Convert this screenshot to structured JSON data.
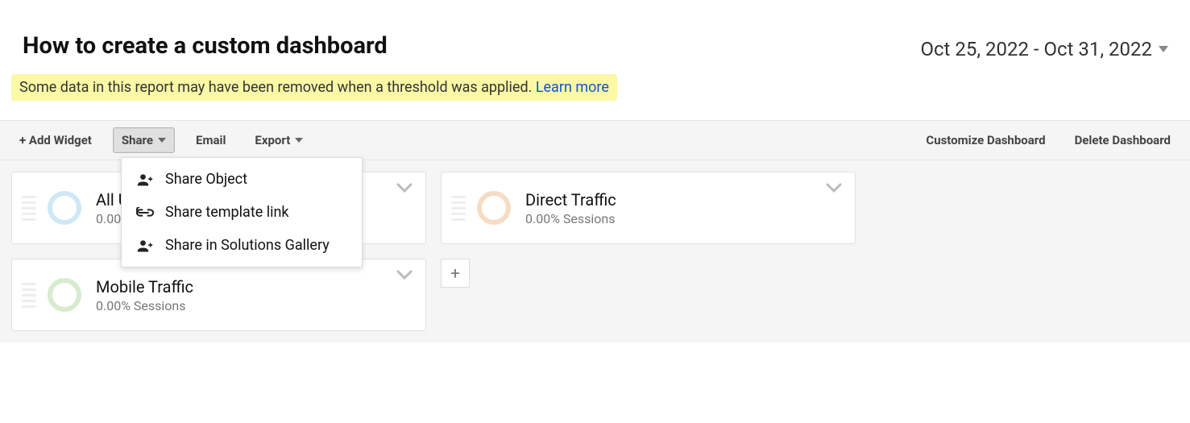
{
  "header": {
    "title": "How to create a custom dashboard",
    "date_range": "Oct 25, 2022 - Oct 31, 2022",
    "warning_text": "Some data in this report may have been removed when a threshold was applied. ",
    "warning_link": "Learn more"
  },
  "toolbar": {
    "add_widget": "+ Add Widget",
    "share": "Share",
    "email": "Email",
    "export": "Export",
    "customize": "Customize Dashboard",
    "delete": "Delete Dashboard"
  },
  "share_menu": {
    "items": [
      {
        "icon": "person-plus-icon",
        "label": "Share Object"
      },
      {
        "icon": "link-icon",
        "label": "Share template link"
      },
      {
        "icon": "person-plus-icon",
        "label": "Share in Solutions Gallery"
      }
    ]
  },
  "widgets": [
    {
      "title": "All Users",
      "subtitle": "0.00% Sessions",
      "color": "blue"
    },
    {
      "title": "Direct Traffic",
      "subtitle": "0.00% Sessions",
      "color": "orange"
    },
    {
      "title": "Mobile Traffic",
      "subtitle": "0.00% Sessions",
      "color": "green"
    }
  ]
}
